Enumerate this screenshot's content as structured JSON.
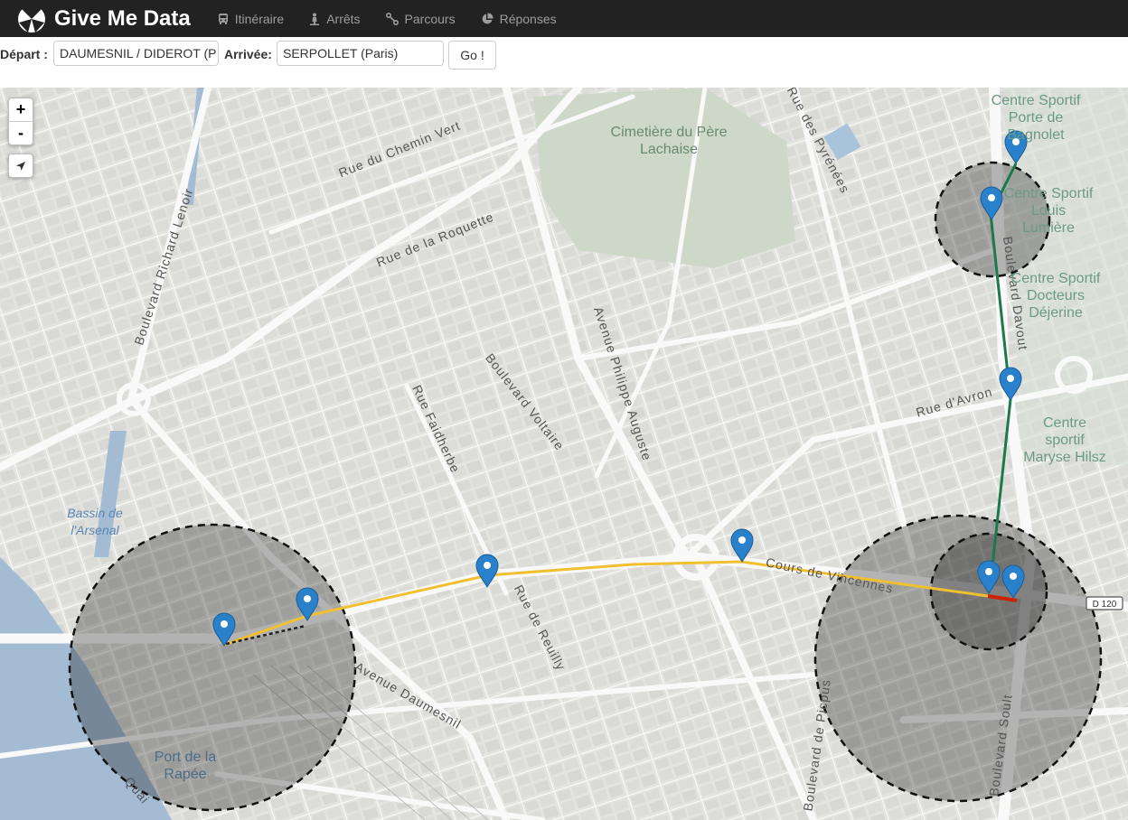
{
  "navbar": {
    "brand": "Give Me Data",
    "items": [
      {
        "label": "Itinéraire",
        "icon": "bus-icon"
      },
      {
        "label": "Arrêts",
        "icon": "person-stop-icon"
      },
      {
        "label": "Parcours",
        "icon": "route-icon"
      },
      {
        "label": "Réponses",
        "icon": "pie-chart-icon"
      }
    ]
  },
  "form": {
    "depart_label": "Départ :",
    "depart_value": "DAUMESNIL / DIDEROT (P",
    "arrivee_label": "Arrivée:",
    "arrivee_value": "SERPOLLET (Paris)",
    "go_label": "Go !"
  },
  "map": {
    "zoom_in": "+",
    "zoom_out": "-",
    "streets": [
      "Rue du Chemin Vert",
      "Rue de la Roquette",
      "Boulevard Richard Lenoir",
      "Avenue Philippe Auguste",
      "Boulevard Voltaire",
      "Rue Faidherbe",
      "Rue des Pyrénées",
      "Rue d'Avron",
      "Cours de Vincennes",
      "Rue de Reuilly",
      "Avenue Daumesnil",
      "Boulevard de Picpus",
      "Boulevard Davout",
      "Boulevard Soult",
      "Quai"
    ],
    "places": [
      "Cimetière du Père Lachaise",
      "Centre Sportif Porte de Bagnolet",
      "Centre Sportif Louis Lumière",
      "Centre Sportif Docteurs Déjerine",
      "Centre sportif Maryse Hilsz",
      "Bassin de l'Arsenal",
      "Port de la Rapée"
    ],
    "road_shield": "D 120",
    "colors": {
      "route_main": "#f0c030",
      "route_branch": "#1a7a4a",
      "route_short": "#cc2200",
      "marker": "#2a81cb"
    }
  }
}
